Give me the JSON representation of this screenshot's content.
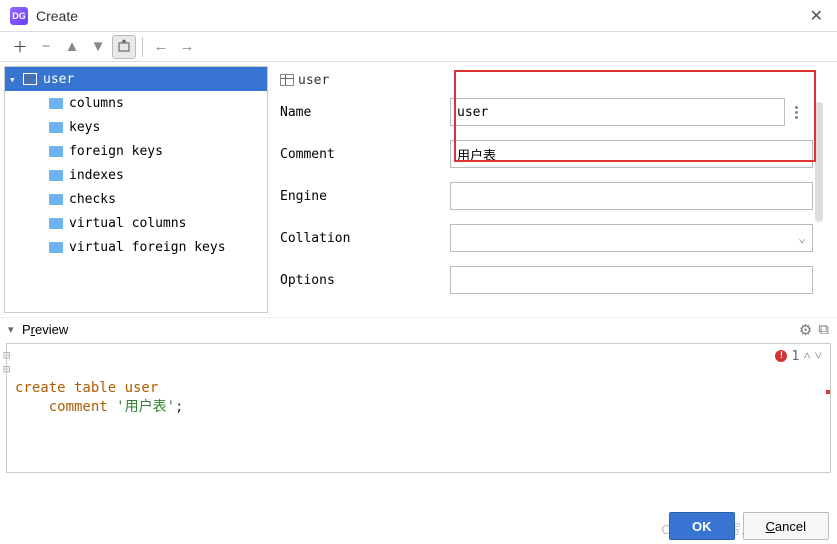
{
  "window": {
    "title": "Create",
    "app_badge": "DG"
  },
  "tree": {
    "root": "user",
    "children": [
      "columns",
      "keys",
      "foreign keys",
      "indexes",
      "checks",
      "virtual columns",
      "virtual foreign keys"
    ]
  },
  "tab": {
    "label": "user"
  },
  "form": {
    "name_label": "Name",
    "name_value": "user",
    "comment_label": "Comment",
    "comment_value": "用户表",
    "engine_label": "Engine",
    "engine_value": "",
    "collation_label": "Collation",
    "collation_value": "",
    "options_label": "Options",
    "options_value": ""
  },
  "preview": {
    "label_pre": "P",
    "label_underlined": "r",
    "label_post": "eview",
    "error_count": "1"
  },
  "sql": {
    "kw_create": "create table ",
    "ident": "user",
    "indent": "    ",
    "kw_comment": "comment ",
    "str": "'用户表'",
    "tail": ";"
  },
  "buttons": {
    "ok": "OK",
    "cancel": "Cancel"
  },
  "watermark": "CSDN @不写八个"
}
